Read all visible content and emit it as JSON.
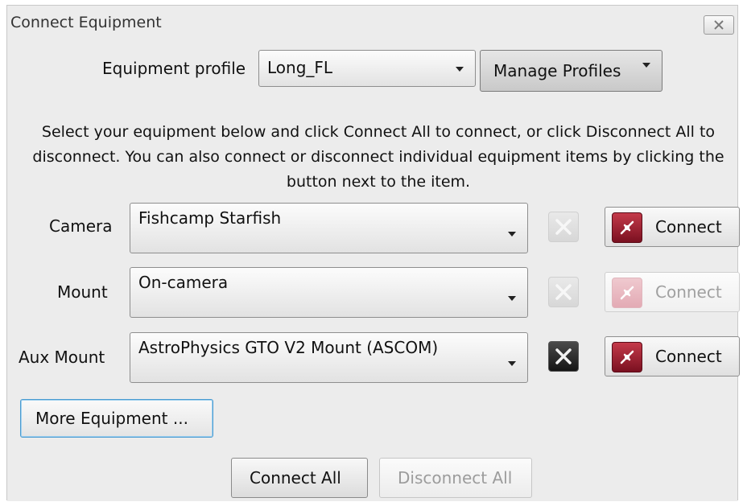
{
  "window": {
    "title": "Connect Equipment",
    "close_label": "close"
  },
  "profile": {
    "label": "Equipment profile",
    "value": "Long_FL",
    "manage_label": "Manage Profiles"
  },
  "instructions": "Select your equipment below and click Connect All to connect, or click Disconnect All to disconnect. You can also connect or disconnect individual equipment items by clicking the button next to the item.",
  "equipment": [
    {
      "label": "Camera",
      "value": "Fishcamp Starfish",
      "connect_label": "Connect",
      "setup_enabled": false,
      "connect_enabled": true
    },
    {
      "label": "Mount",
      "value": "On-camera",
      "connect_label": "Connect",
      "setup_enabled": false,
      "connect_enabled": false
    },
    {
      "label": "Aux Mount",
      "value": "AstroPhysics GTO V2 Mount (ASCOM)",
      "connect_label": "Connect",
      "setup_enabled": true,
      "connect_enabled": true
    }
  ],
  "more_equipment_label": "More Equipment ...",
  "connect_all_label": "Connect All",
  "disconnect_all_label": "Disconnect All",
  "icons": {
    "setup": "wrench-screwdriver-icon",
    "connect": "plug-icon",
    "close": "close-icon"
  },
  "colors": {
    "dialog_bg": "#ececec",
    "connect_icon": "#a01828",
    "focus_border": "#4a9bd0"
  }
}
